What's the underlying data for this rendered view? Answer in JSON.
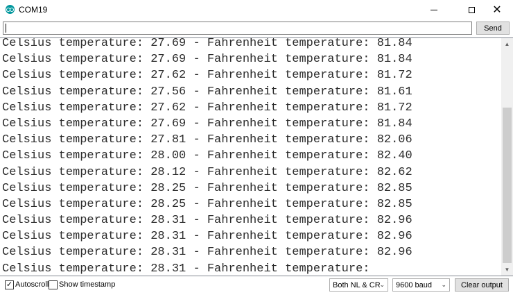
{
  "window": {
    "title": "COM19",
    "minimize_glyph": "—",
    "maximize_glyph": "☐",
    "close_glyph": "✕"
  },
  "input_row": {
    "value": "",
    "send_label": "Send"
  },
  "output": {
    "lines": [
      "Celsius temperature: 27.69 - Fahrenheit temperature: 81.84",
      "Celsius temperature: 27.69 - Fahrenheit temperature: 81.84",
      "Celsius temperature: 27.62 - Fahrenheit temperature: 81.72",
      "Celsius temperature: 27.56 - Fahrenheit temperature: 81.61",
      "Celsius temperature: 27.62 - Fahrenheit temperature: 81.72",
      "Celsius temperature: 27.69 - Fahrenheit temperature: 81.84",
      "Celsius temperature: 27.81 - Fahrenheit temperature: 82.06",
      "Celsius temperature: 28.00 - Fahrenheit temperature: 82.40",
      "Celsius temperature: 28.12 - Fahrenheit temperature: 82.62",
      "Celsius temperature: 28.25 - Fahrenheit temperature: 82.85",
      "Celsius temperature: 28.25 - Fahrenheit temperature: 82.85",
      "Celsius temperature: 28.31 - Fahrenheit temperature: 82.96",
      "Celsius temperature: 28.31 - Fahrenheit temperature: 82.96",
      "Celsius temperature: 28.31 - Fahrenheit temperature: 82.96",
      "Celsius temperature: 28.31 - Fahrenheit temperature:"
    ]
  },
  "bottom_bar": {
    "autoscroll_label": "Autoscroll",
    "autoscroll_checked": true,
    "autoscroll_mark": "✓",
    "timestamp_label": "Show timestamp",
    "timestamp_checked": false,
    "line_ending_value": "Both NL & CR",
    "baud_value": "9600 baud",
    "clear_label": "Clear output"
  },
  "icons": {
    "app": "arduino-icon",
    "dropdown": "chevron-down-icon",
    "scroll_up": "scroll-up-arrow-icon",
    "scroll_down": "scroll-down-arrow-icon"
  },
  "colors": {
    "app_icon": "#00979d",
    "button_bg": "#e1e1e1",
    "scrollbar_track": "#f0f0f0",
    "scrollbar_thumb": "#cdcdcd"
  }
}
